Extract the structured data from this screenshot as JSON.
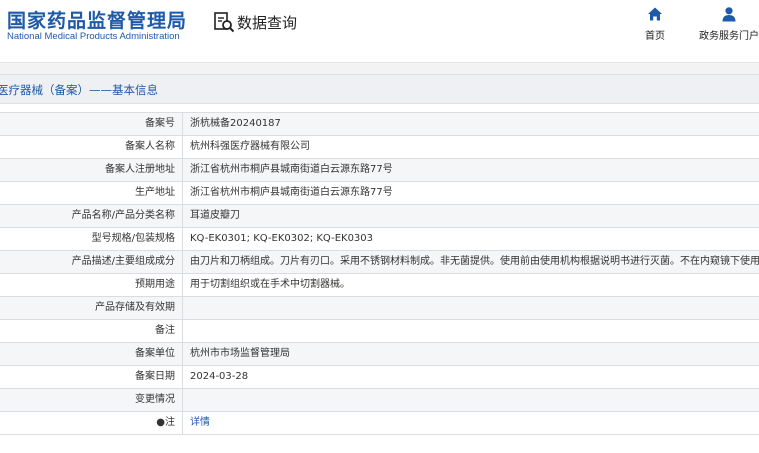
{
  "header": {
    "logo_cn": "国家药品监督管理局",
    "logo_en": "National Medical Products Administration",
    "query_label": "数据查询",
    "nav": [
      {
        "label": "首页",
        "icon": "home-icon"
      },
      {
        "label": "政务服务门户",
        "icon": "user-icon"
      }
    ]
  },
  "section": {
    "title": "医疗器械（备案）——基本信息"
  },
  "rows": [
    {
      "label": "备案号",
      "value": "浙杭械备20240187"
    },
    {
      "label": "备案人名称",
      "value": "杭州科强医疗器械有限公司"
    },
    {
      "label": "备案人注册地址",
      "value": "浙江省杭州市桐庐县城南街道白云源东路77号"
    },
    {
      "label": "生产地址",
      "value": "浙江省杭州市桐庐县城南街道白云源东路77号"
    },
    {
      "label": "产品名称/产品分类名称",
      "value": "耳道皮瓣刀"
    },
    {
      "label": "型号规格/包装规格",
      "value": "KQ-EK0301; KQ-EK0302; KQ-EK0303"
    },
    {
      "label": "产品描述/主要组成成分",
      "value": "由刀片和刀柄组成。刀片有刃口。采用不锈钢材料制成。非无菌提供。使用前由使用机构根据说明书进行灭菌。不在内窥镜下使用。"
    },
    {
      "label": "预期用途",
      "value": "用于切割组织或在手术中切割器械。"
    },
    {
      "label": "产品存储及有效期",
      "value": ""
    },
    {
      "label": "备注",
      "value": ""
    },
    {
      "label": "备案单位",
      "value": "杭州市市场监督管理局"
    },
    {
      "label": "备案日期",
      "value": "2024-03-28"
    },
    {
      "label": "变更情况",
      "value": ""
    },
    {
      "label": "●注",
      "value": "详情"
    }
  ],
  "colors": {
    "brand_blue": "#1e5aa8",
    "section_bg": "#eef0f3",
    "row_alt_bg": "#f5f6f8"
  }
}
